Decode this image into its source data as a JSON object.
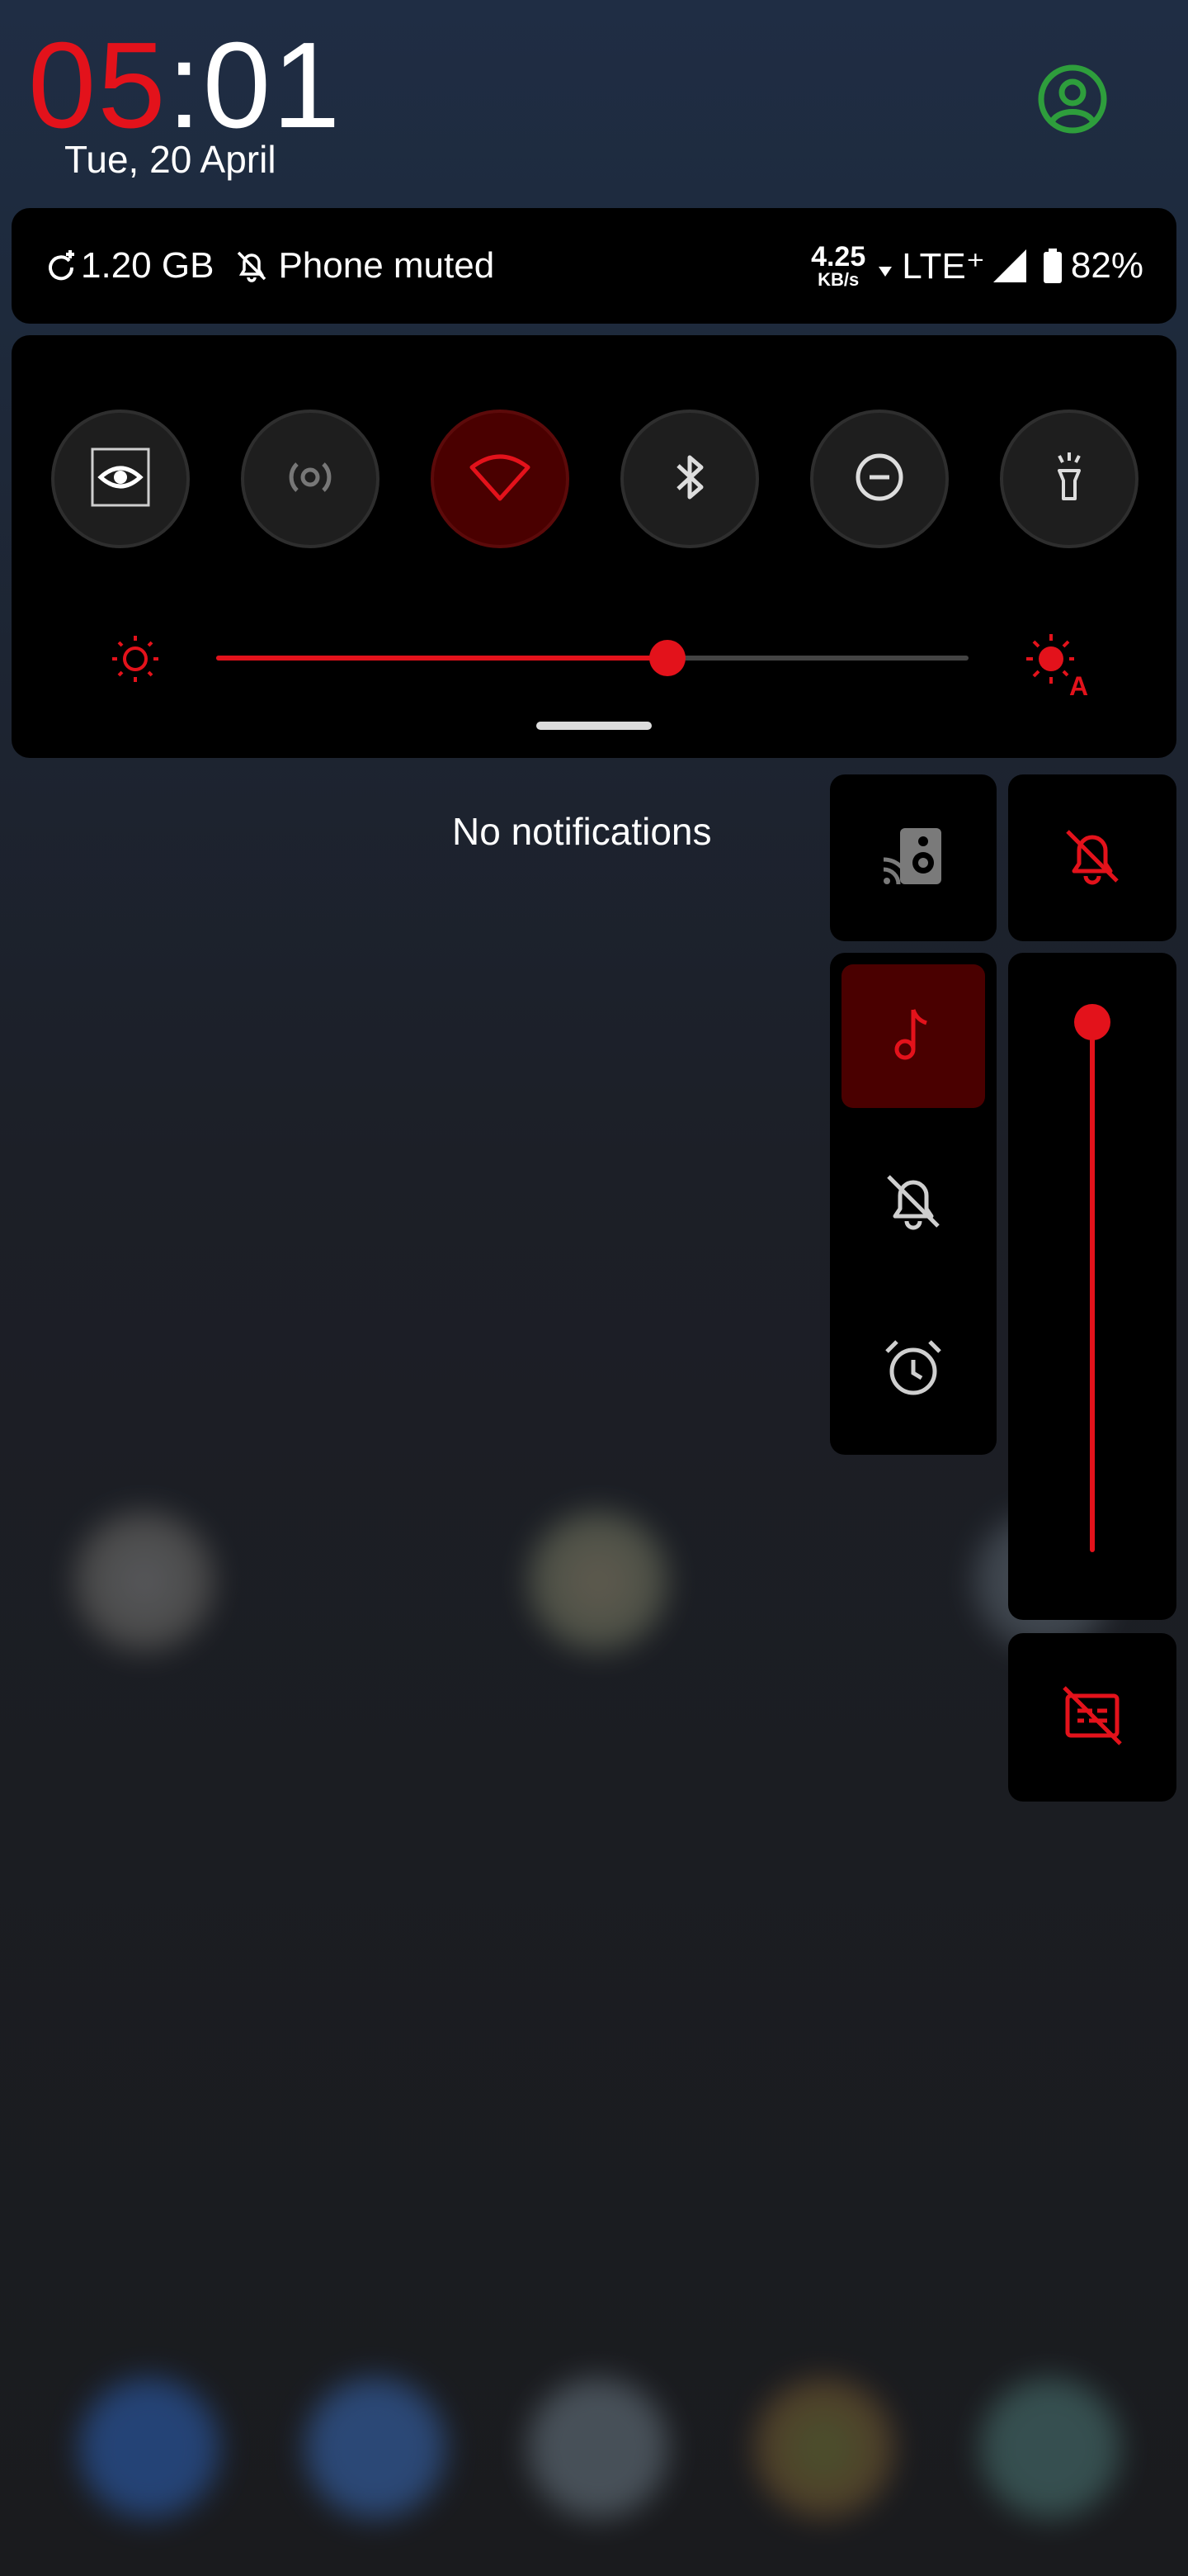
{
  "lockscreen": {
    "clock_hours": "05",
    "clock_rest": ":01",
    "date": "Tue, 20 April",
    "user_icon": "account-circle-icon"
  },
  "status": {
    "data_usage": "1.20 GB",
    "ringer_status": "Phone muted",
    "net_speed_value": "4.25",
    "net_speed_unit": "KB/s",
    "network": "LTE⁺",
    "battery": "82%",
    "battery_level_percent": 82
  },
  "quick_settings": {
    "tiles": [
      {
        "name": "screen-recognition",
        "icon": "eye-scan-icon",
        "active": false
      },
      {
        "name": "hotspot",
        "icon": "hotspot-icon",
        "active": false
      },
      {
        "name": "wifi",
        "icon": "wifi-icon",
        "active": true
      },
      {
        "name": "bluetooth",
        "icon": "bluetooth-icon",
        "active": false
      },
      {
        "name": "do-not-disturb",
        "icon": "minus-circle-icon",
        "active": false
      },
      {
        "name": "flashlight",
        "icon": "flashlight-icon",
        "active": false
      }
    ],
    "brightness_percent": 60,
    "brightness_auto": true
  },
  "notifications": {
    "empty_text": "No notifications"
  },
  "volume_panel": {
    "cast_icon": "cast-speaker-icon",
    "ringer_icon": "bell-off-icon",
    "modes": [
      {
        "name": "sound",
        "icon": "music-note-icon",
        "active": true
      },
      {
        "name": "mute",
        "icon": "bell-off-icon",
        "active": false
      },
      {
        "name": "alarm",
        "icon": "alarm-clock-icon",
        "active": false
      }
    ],
    "volume_percent": 100,
    "captions_icon": "captions-off-icon"
  },
  "colors": {
    "accent": "#e3121b",
    "active_tile": "#4a0000",
    "panel": "#000000",
    "user_icon": "#2e9e3c"
  }
}
